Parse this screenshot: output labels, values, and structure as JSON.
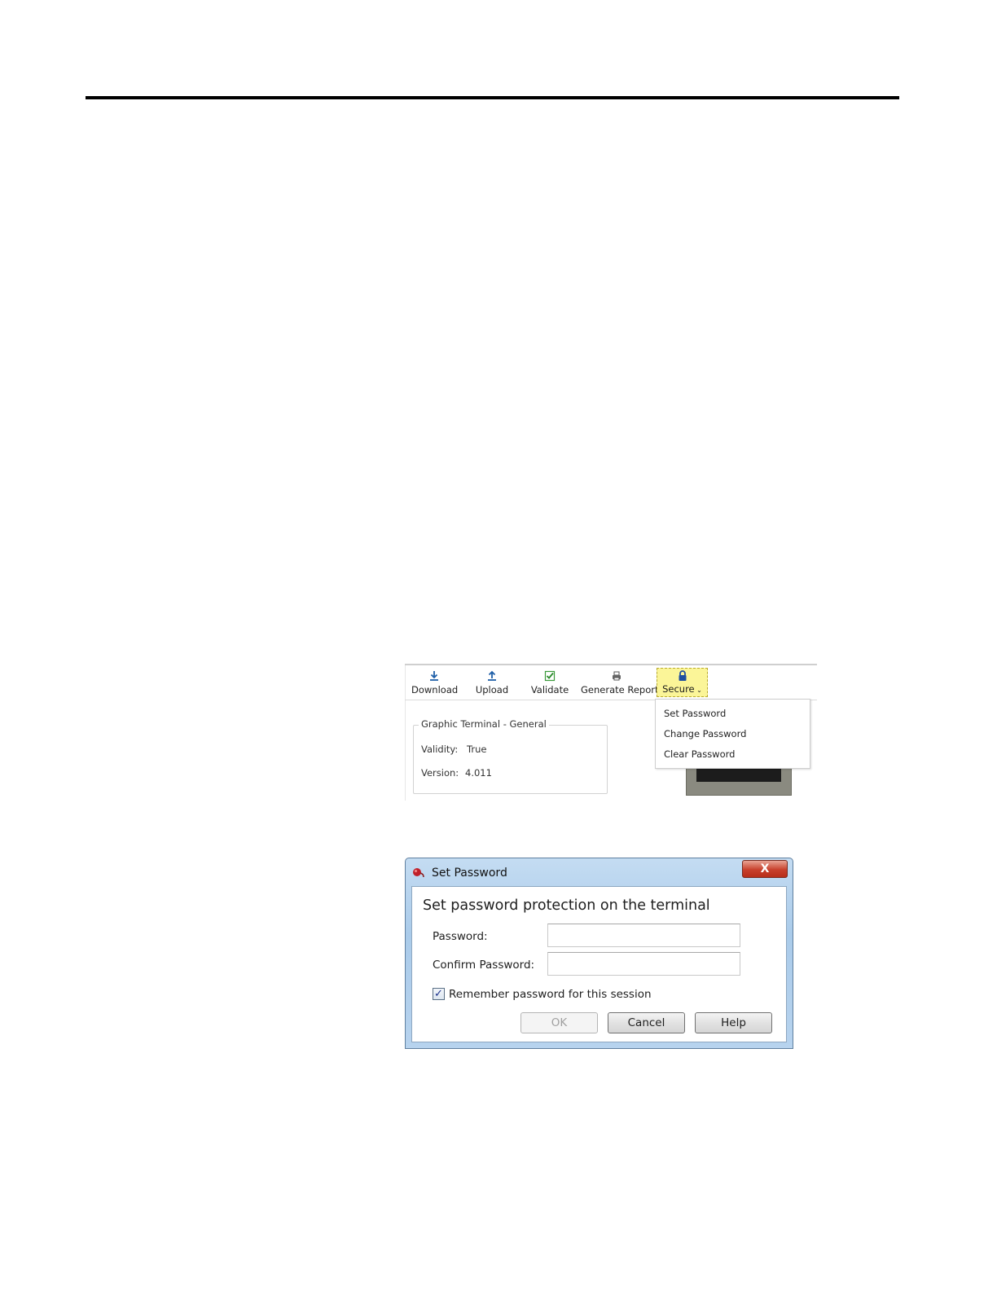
{
  "toolbar": {
    "buttons": [
      {
        "label": "Download",
        "icon": "download-icon"
      },
      {
        "label": "Upload",
        "icon": "upload-icon"
      },
      {
        "label": "Validate",
        "icon": "validate-check-icon"
      },
      {
        "label": "Generate Report",
        "icon": "printer-icon"
      },
      {
        "label": "Secure",
        "icon": "lock-icon"
      }
    ],
    "secure_highlight_color": "#fbf598"
  },
  "secure_menu": {
    "items": [
      "Set Password",
      "Change Password",
      "Clear Password"
    ]
  },
  "terminal_panel": {
    "title": "Graphic Terminal - General",
    "validity_label": "Validity:",
    "validity_value": "True",
    "version_label": "Version:",
    "version_value": "4.011"
  },
  "dialog": {
    "title": "Set Password",
    "close_glyph": "X",
    "heading": "Set password protection on the terminal",
    "password_label": "Password:",
    "password_value": "",
    "confirm_label": "Confirm Password:",
    "confirm_value": "",
    "remember_label": "Remember password for this session",
    "remember_checked": true,
    "check_glyph": "✓",
    "ok_label": "OK",
    "cancel_label": "Cancel",
    "help_label": "Help"
  }
}
